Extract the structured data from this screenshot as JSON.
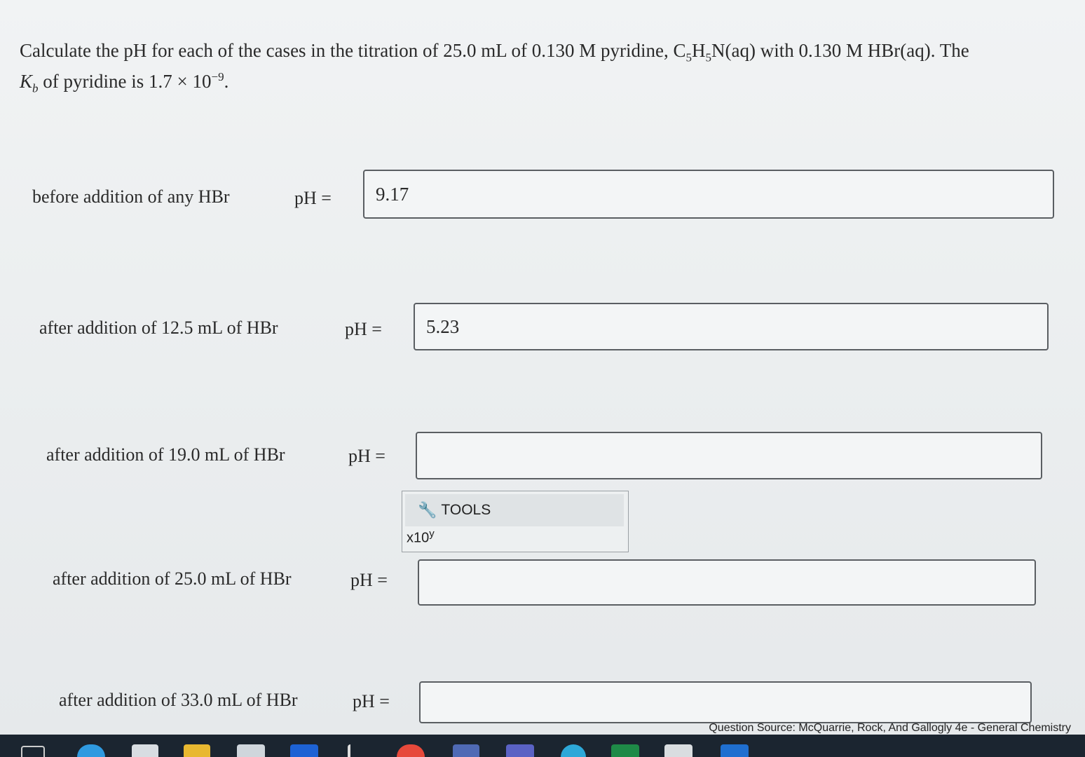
{
  "question": {
    "text_before": "Calculate the pH for each of the cases in the titration of 25.0 mL of 0.130 M pyridine, C",
    "sub1": "5",
    "h": "H",
    "sub2": "5",
    "text_after": "N(aq) with 0.130 M HBr(aq). The",
    "kb_symbol": "K",
    "kb_sub": "b",
    "kb_text": " of pyridine is 1.7 × 10",
    "kb_exp": "−9",
    "kb_end": "."
  },
  "rows": [
    {
      "label": "before addition of any HBr",
      "ph_label": "pH =",
      "value": "9.17"
    },
    {
      "label": "after addition of 12.5 mL of HBr",
      "ph_label": "pH =",
      "value": "5.23"
    },
    {
      "label": "after addition of 19.0 mL of HBr",
      "ph_label": "pH =",
      "value": ""
    },
    {
      "label": "after addition of 25.0 mL of HBr",
      "ph_label": "pH =",
      "value": ""
    },
    {
      "label": "after addition of 33.0 mL of HBr",
      "ph_label": "pH =",
      "value": ""
    }
  ],
  "tools": {
    "icon": "wrench-icon",
    "label": "TOOLS",
    "x10_base": "x10",
    "x10_exp": "y"
  },
  "source": "Question Source: McQuarrie, Rock, And Gallogly 4e - General Chemistry",
  "taskbar": {
    "icons": [
      "task-view-icon",
      "edge-icon",
      "store-icon",
      "file-explorer-icon",
      "mail-icon",
      "dropbox-icon",
      "app-icon",
      "chrome-icon",
      "app-icon",
      "teams-icon",
      "app-icon",
      "excel-icon",
      "app-icon",
      "app-icon"
    ]
  }
}
